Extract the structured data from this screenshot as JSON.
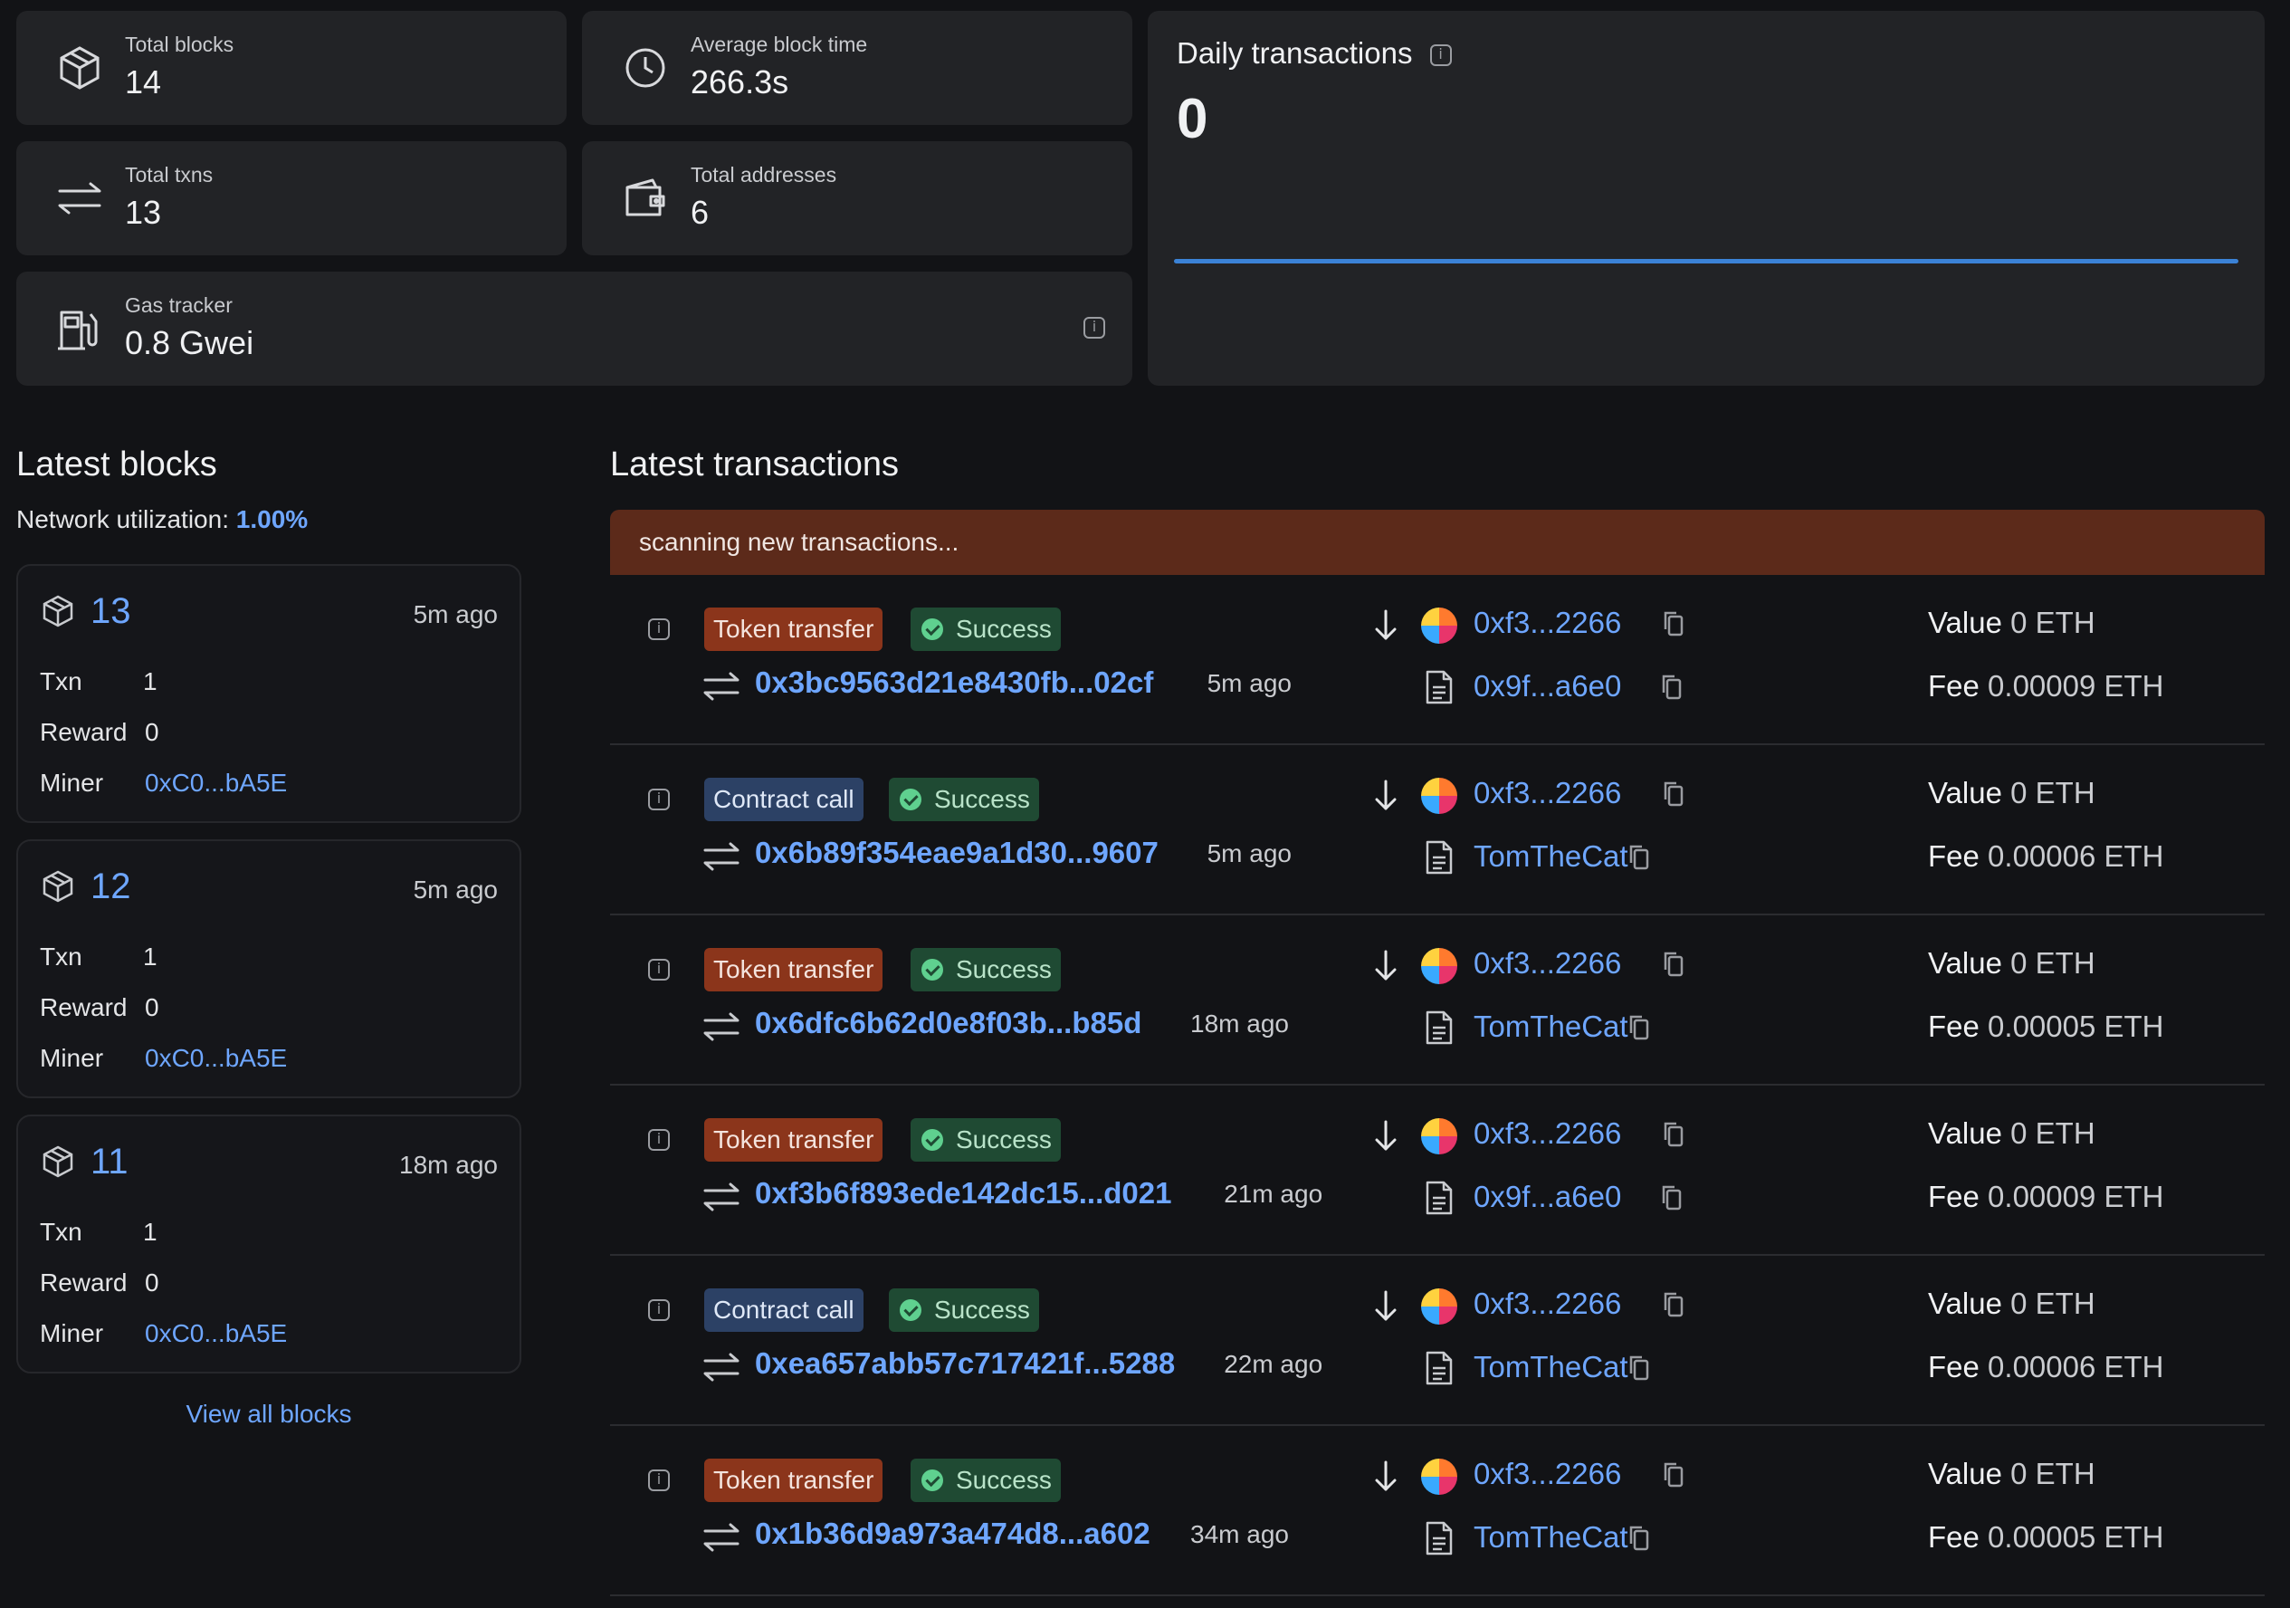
{
  "stats": {
    "total_blocks": {
      "label": "Total blocks",
      "value": "14"
    },
    "avg_block_time": {
      "label": "Average block time",
      "value": "266.3s"
    },
    "total_txns": {
      "label": "Total txns",
      "value": "13"
    },
    "total_addresses": {
      "label": "Total addresses",
      "value": "6"
    },
    "gas_tracker": {
      "label": "Gas tracker",
      "value": "0.8 Gwei"
    }
  },
  "daily": {
    "title": "Daily transactions",
    "value": "0"
  },
  "latest_blocks": {
    "title": "Latest blocks",
    "utilization_label": "Network utilization:",
    "utilization_value": "1.00%",
    "labels": {
      "txn": "Txn",
      "reward": "Reward",
      "miner": "Miner"
    },
    "items": [
      {
        "number": "13",
        "age": "5m ago",
        "txn": "1",
        "reward": "0",
        "miner": "0xC0...bA5E"
      },
      {
        "number": "12",
        "age": "5m ago",
        "txn": "1",
        "reward": "0",
        "miner": "0xC0...bA5E"
      },
      {
        "number": "11",
        "age": "18m ago",
        "txn": "1",
        "reward": "0",
        "miner": "0xC0...bA5E"
      }
    ],
    "view_all": "View all blocks"
  },
  "latest_transactions": {
    "title": "Latest transactions",
    "scanning": "scanning new transactions...",
    "value_label": "Value",
    "fee_label": "Fee",
    "items": [
      {
        "type": "Token transfer",
        "status": "Success",
        "hash": "0x3bc9563d21e8430fb...02cf",
        "age": "5m ago",
        "from": "0xf3...2266",
        "to": "0x9f...a6e0",
        "value": "0 ETH",
        "fee": "0.00009 ETH"
      },
      {
        "type": "Contract call",
        "status": "Success",
        "hash": "0x6b89f354eae9a1d30...9607",
        "age": "5m ago",
        "from": "0xf3...2266",
        "to": "TomTheCat",
        "value": "0 ETH",
        "fee": "0.00006 ETH"
      },
      {
        "type": "Token transfer",
        "status": "Success",
        "hash": "0x6dfc6b62d0e8f03b...b85d",
        "age": "18m ago",
        "from": "0xf3...2266",
        "to": "TomTheCat",
        "value": "0 ETH",
        "fee": "0.00005 ETH"
      },
      {
        "type": "Token transfer",
        "status": "Success",
        "hash": "0xf3b6f893ede142dc15...d021",
        "age": "21m ago",
        "from": "0xf3...2266",
        "to": "0x9f...a6e0",
        "value": "0 ETH",
        "fee": "0.00009 ETH"
      },
      {
        "type": "Contract call",
        "status": "Success",
        "hash": "0xea657abb57c717421f...5288",
        "age": "22m ago",
        "from": "0xf3...2266",
        "to": "TomTheCat",
        "value": "0 ETH",
        "fee": "0.00006 ETH"
      },
      {
        "type": "Token transfer",
        "status": "Success",
        "hash": "0x1b36d9a973a474d8...a602",
        "age": "34m ago",
        "from": "0xf3...2266",
        "to": "TomTheCat",
        "value": "0 ETH",
        "fee": "0.00005 ETH"
      }
    ]
  },
  "colors": {
    "accent": "#6ea6ff",
    "chart_line": "#3b82d6",
    "scan_bar": "#5c2a1a",
    "token_tag": "#8b351b",
    "contract_tag": "#2c4165",
    "success_tag": "#1f4a33"
  }
}
